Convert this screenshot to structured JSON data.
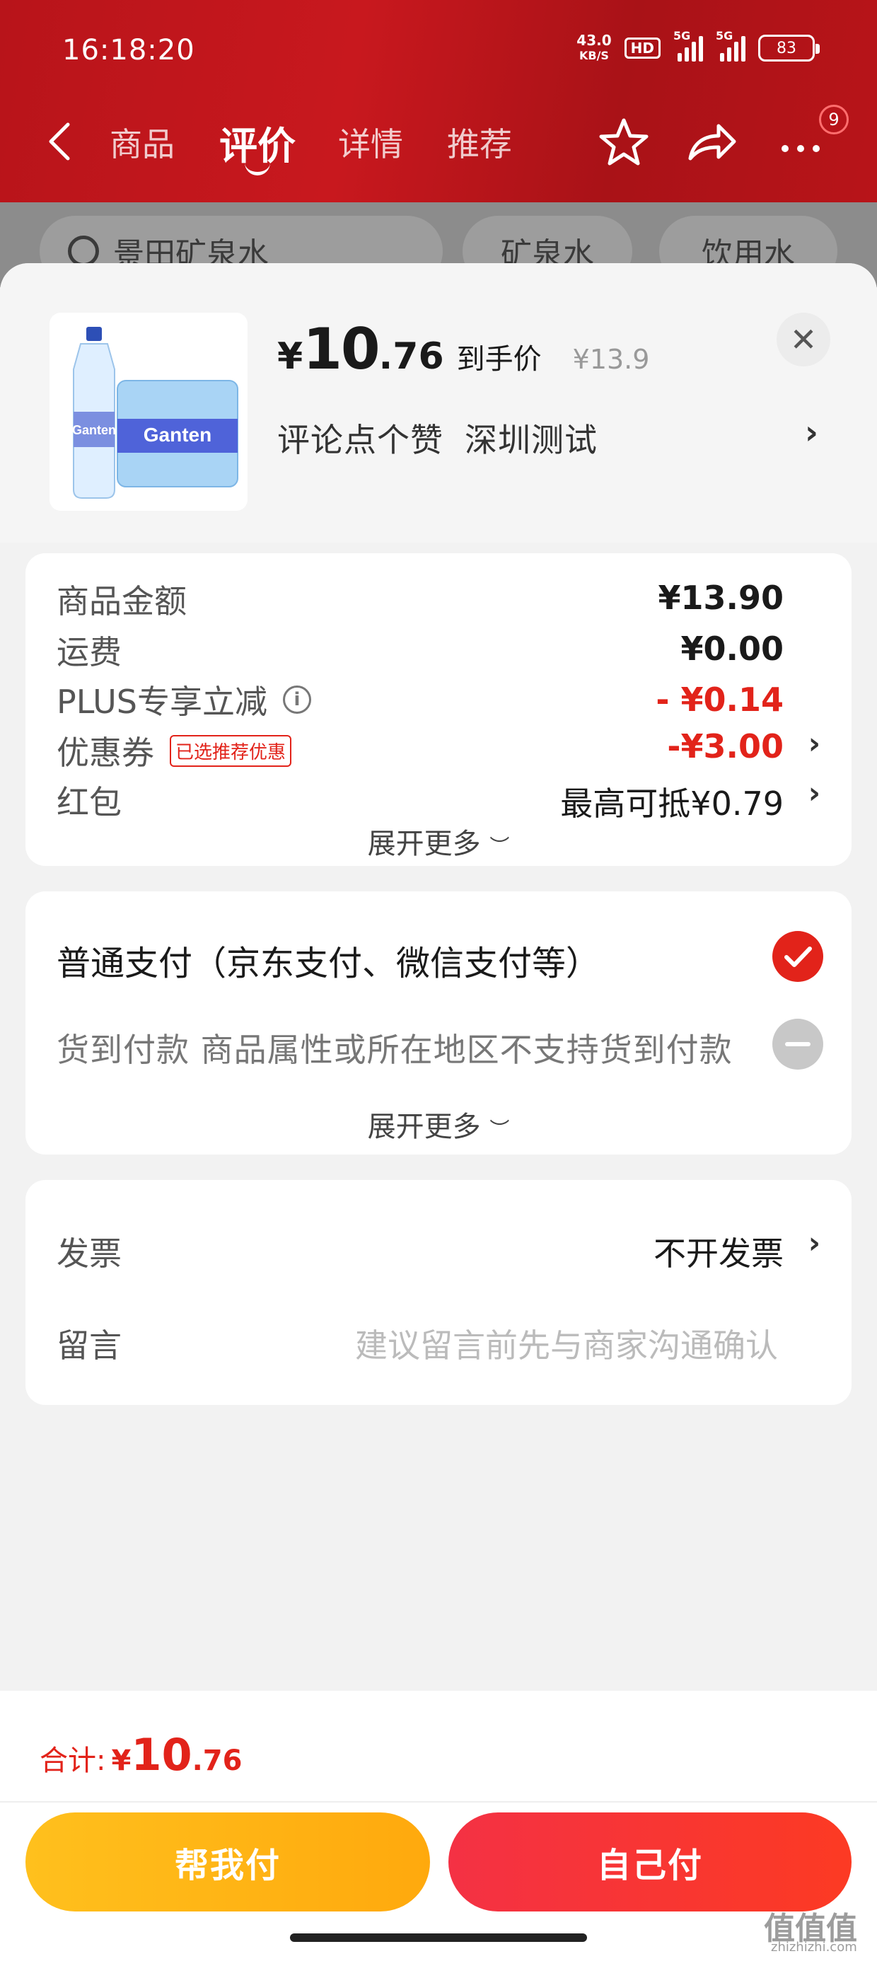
{
  "status_bar": {
    "time": "16:18:20",
    "net_speed_value": "43.0",
    "net_speed_unit": "KB/S",
    "hd_label": "HD",
    "signal1_label": "5G",
    "signal2_label": "5G",
    "battery": "83"
  },
  "nav": {
    "tabs": [
      "商品",
      "评价",
      "详情",
      "推荐"
    ],
    "active_tab": "评价",
    "more_badge": "9"
  },
  "background_page": {
    "search_text": "景田矿泉水",
    "chips": [
      "矿泉水",
      "饮用水"
    ]
  },
  "product": {
    "price_symbol": "¥",
    "price_int": "10",
    "price_dec": ".76",
    "price_tag": "到手价",
    "original_price": "¥13.9",
    "subtitle_1": "评论点个赞",
    "subtitle_2": "深圳测试",
    "image_brand": "Ganten"
  },
  "summary": {
    "rows": [
      {
        "label": "商品金额",
        "value": "¥13.90"
      },
      {
        "label": "运费",
        "value": "¥0.00"
      },
      {
        "label": "PLUS专享立减",
        "value": "- ¥0.14"
      },
      {
        "label": "优惠券",
        "tag": "已选推荐优惠",
        "value": "-¥3.00"
      },
      {
        "label": "红包",
        "value": "最高可抵¥0.79"
      }
    ],
    "expand_label": "展开更多"
  },
  "payment": {
    "normal_label": "普通支付（京东支付、微信支付等）",
    "cod_label": "货到付款 商品属性或所在地区不支持货到付款",
    "expand_label": "展开更多"
  },
  "extras": {
    "invoice_label": "发票",
    "invoice_value": "不开发票",
    "message_label": "留言",
    "message_placeholder": "建议留言前先与商家沟通确认"
  },
  "footer": {
    "total_label": "合计:",
    "total_symbol": "¥",
    "total_int": "10",
    "total_dec": ".76",
    "help_pay_label": "帮我付",
    "self_pay_label": "自己付"
  },
  "watermark": {
    "text": "值值值",
    "url": "zhizhizhi.com"
  },
  "colors": {
    "brand_red": "#e2231a",
    "header_red": "#b8141a",
    "help_pay_yellow": "#ffb515",
    "self_pay_red": "#f43144"
  }
}
